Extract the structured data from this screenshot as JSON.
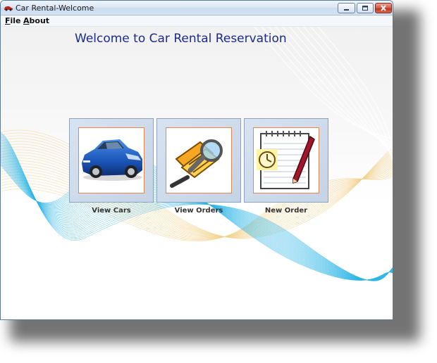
{
  "window": {
    "title": "Car Rental-Welcome"
  },
  "menubar": {
    "items": [
      {
        "label": "File",
        "mnemonic": "F",
        "rest": "ile"
      },
      {
        "label": "About",
        "mnemonic": "A",
        "rest": "bout"
      }
    ]
  },
  "main": {
    "heading": "Welcome to Car Rental Reservation",
    "tiles": [
      {
        "label": "View Cars",
        "icon": "car-icon"
      },
      {
        "label": "View Orders",
        "icon": "document-magnifier-icon"
      },
      {
        "label": "New Order",
        "icon": "notepad-clock-pen-icon"
      }
    ]
  },
  "colors": {
    "heading": "#1b2a8e",
    "tile_border": "#8ea2bb",
    "tile_inner_border": "#e0884f",
    "wave_blue": "#2ab4e6",
    "wave_yellow": "#f2d28a"
  }
}
